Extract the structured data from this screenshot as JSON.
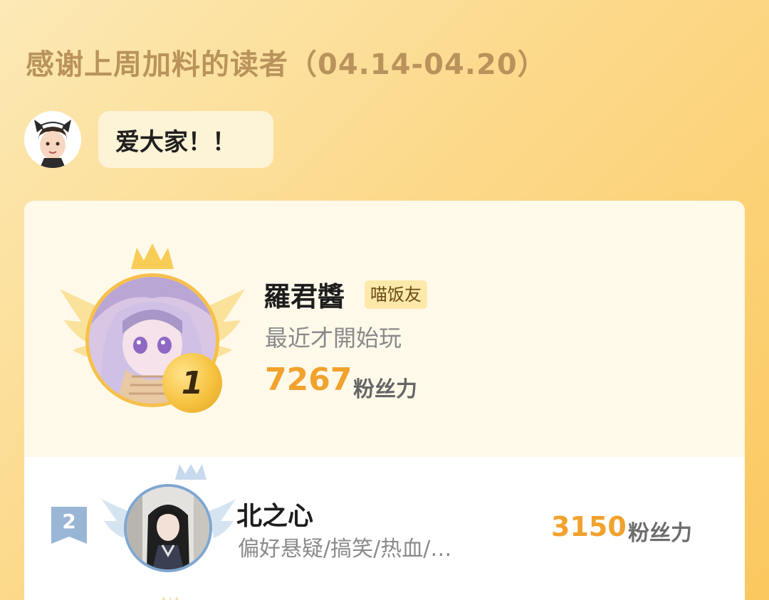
{
  "header": {
    "title": "感谢上周加料的读者（04.14-04.20）"
  },
  "author_note": {
    "message": "爱大家！！"
  },
  "leaderboard": {
    "first": {
      "rank": "1",
      "name": "羅君醬",
      "badge": "喵饭友",
      "description": "最近才開始玩",
      "score": "7267",
      "unit": "粉丝力"
    },
    "second": {
      "rank": "2",
      "name": "北之心",
      "description": "偏好悬疑/搞笑/热血/…",
      "score": "3150",
      "unit": "粉丝力"
    }
  },
  "colors": {
    "background": "#fcd98a",
    "title": "#b9935b",
    "score": "#f1a22d",
    "gold": "#f6c04a",
    "silver_blue": "#7ea7d0"
  }
}
